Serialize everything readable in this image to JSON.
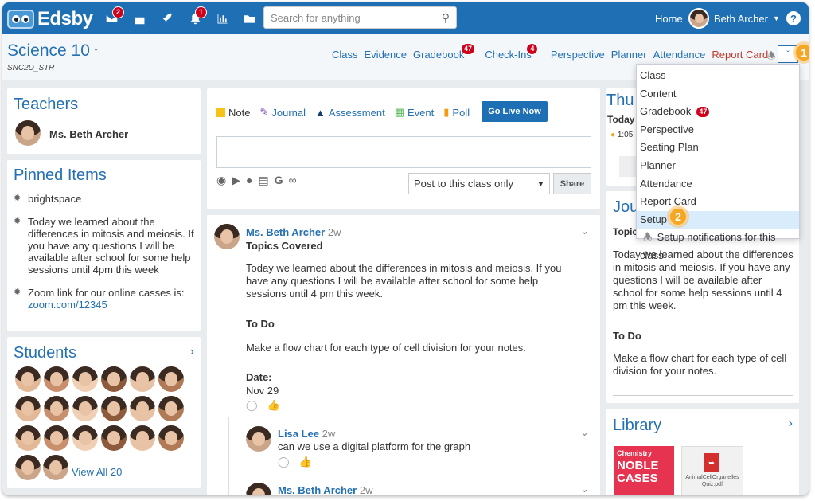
{
  "topbar": {
    "logo_text": "Edsby",
    "messages_badge": "2",
    "notifications_badge": "1",
    "search_placeholder": "Search for anything",
    "home_label": "Home",
    "user_name": "Beth Archer",
    "icons": [
      "messages-icon",
      "calendar-icon",
      "rocket-icon",
      "bell-icon",
      "chart-icon",
      "folder-icon",
      "search-icon",
      "help-icon"
    ]
  },
  "classbar": {
    "title": "Science 10",
    "code": "SNC2D_STR",
    "tabs": [
      {
        "label": "Class"
      },
      {
        "label": "Evidence"
      },
      {
        "label": "Gradebook",
        "badge": "47"
      },
      {
        "label": "Check-Ins",
        "badge": "4"
      },
      {
        "label": "Perspective"
      },
      {
        "label": "Planner"
      },
      {
        "label": "Attendance"
      },
      {
        "label": "Report Card"
      }
    ]
  },
  "teachers": {
    "heading": "Teachers",
    "name": "Ms. Beth Archer"
  },
  "pinned": {
    "heading": "Pinned Items",
    "items": [
      {
        "text": "brightspace"
      },
      {
        "text": "Today we learned about the differences in mitosis and meiosis. If you have any questions I will be available after school for some help sessions until 4pm this week"
      },
      {
        "text": "Zoom link for our online casses is:",
        "link": "zoom.com/12345"
      }
    ]
  },
  "students": {
    "heading": "Students",
    "view_all": "View All 20"
  },
  "composer": {
    "types": [
      "Note",
      "Journal",
      "Assessment",
      "Event",
      "Poll"
    ],
    "go_live": "Go Live Now",
    "post_scope": "Post to this class only",
    "share": "Share"
  },
  "post": {
    "author": "Ms. Beth Archer",
    "age": "2w",
    "title": "Topics Covered",
    "body": "Today we learned about the differences in mitosis and meiosis. If you have any questions I will be available after school for some help sessions until 4 pm this week.",
    "todo_heading": "To Do",
    "todo": "Make a flow chart for each type of cell division for your notes.",
    "date_label": "Date:",
    "date": "Nov 29"
  },
  "reply": {
    "author": "Lisa Lee",
    "age": "2w",
    "text": "can we use a digital platform for the graph"
  },
  "reply2": {
    "author": "Ms. Beth Archer",
    "age": "2w"
  },
  "right": {
    "day_title": "Thu",
    "today": "Today",
    "time": "1:05",
    "journal_heading": "Jou",
    "journal_sub": "Topic",
    "journal_body": "Today we learned about the differences in mitosis and meiosis. If you have any questions I will be available after school for some help sessions until 4 pm this week.",
    "todo_heading": "To Do",
    "todo": "Make a flow chart for each type of cell division for your notes.",
    "library_heading": "Library",
    "book_label": "Chemistry",
    "book_title": "NOBLE CASES",
    "pdf_name": "AnimalCellOrganellesQuiz.pdf"
  },
  "menu": {
    "items": [
      {
        "label": "Class"
      },
      {
        "label": "Content"
      },
      {
        "label": "Gradebook",
        "badge": "47"
      },
      {
        "label": "Perspective"
      },
      {
        "label": "Seating Plan"
      },
      {
        "label": "Planner"
      },
      {
        "label": "Attendance"
      },
      {
        "label": "Report Card"
      },
      {
        "label": "Setup"
      },
      {
        "label": "Setup notifications for this class"
      }
    ]
  },
  "steps": {
    "one": "1",
    "two": "2"
  }
}
